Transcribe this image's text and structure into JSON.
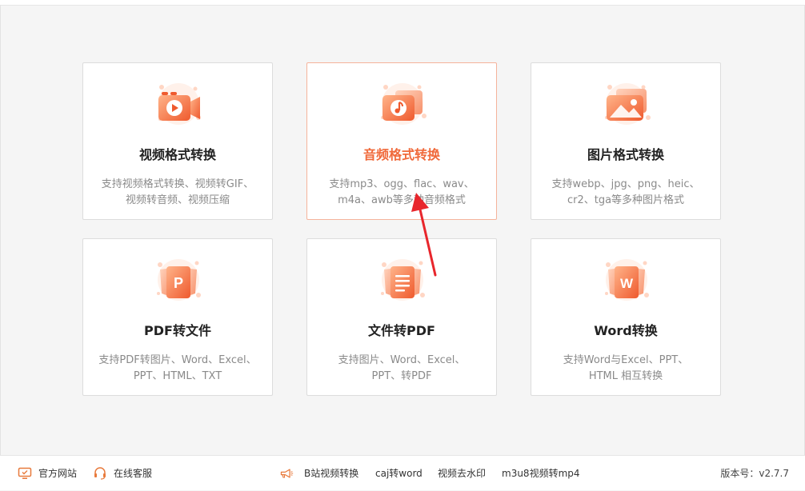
{
  "cards": [
    {
      "title": "视频格式转换",
      "desc_line1": "支持视频格式转换、视频转GIF、",
      "desc_line2": "视频转音频、视频压缩",
      "icon": "video-camera-icon"
    },
    {
      "title": "音频格式转换",
      "desc_line1": "支持mp3、ogg、flac、wav、",
      "desc_line2": "m4a、awb等多种音频格式",
      "icon": "music-note-icon"
    },
    {
      "title": "图片格式转换",
      "desc_line1": "支持webp、jpg、png、heic、",
      "desc_line2": "cr2、tga等多种图片格式",
      "icon": "image-icon"
    },
    {
      "title": "PDF转文件",
      "desc_line1": "支持PDF转图片、Word、Excel、",
      "desc_line2": "PPT、HTML、TXT",
      "icon": "pdf-p-icon"
    },
    {
      "title": "文件转PDF",
      "desc_line1": "支持图片、Word、Excel、",
      "desc_line2": "PPT、转PDF",
      "icon": "document-lines-icon"
    },
    {
      "title": "Word转换",
      "desc_line1": "支持Word与Excel、PPT、",
      "desc_line2": "HTML 相互转换",
      "icon": "word-w-icon"
    }
  ],
  "active_card": "音频格式转换",
  "footer": {
    "official_site": "官方网站",
    "online_service": "在线客服",
    "links": [
      "B站视频转换",
      "caj转word",
      "视频去水印",
      "m3u8视频转mp4"
    ],
    "version": "版本号：v2.7.7"
  },
  "colors": {
    "accent": "#f0693a",
    "active_border": "#f5b39b",
    "arrow": "#e8262c",
    "icon_gradient_start": "#ffb48a",
    "icon_gradient_end": "#ef5a2e"
  }
}
